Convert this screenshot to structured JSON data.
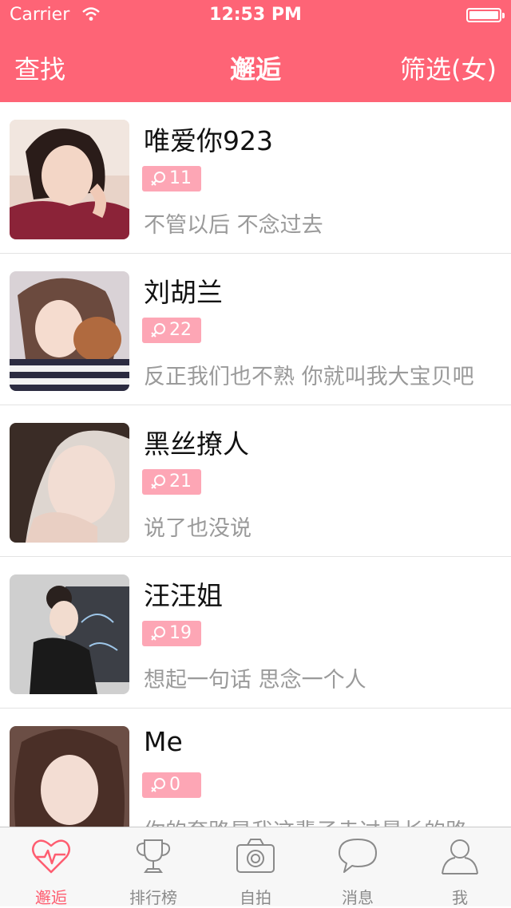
{
  "status_bar": {
    "carrier": "Carrier",
    "time": "12:53 PM"
  },
  "nav": {
    "left": "查找",
    "title": "邂逅",
    "right": "筛选(女)"
  },
  "users": [
    {
      "name": "唯爱你923",
      "age": "11",
      "motto": "不管以后 不念过去"
    },
    {
      "name": "刘胡兰",
      "age": "22",
      "motto": "反正我们也不熟 你就叫我大宝贝吧"
    },
    {
      "name": "黑丝撩人",
      "age": "21",
      "motto": "说了也没说"
    },
    {
      "name": "汪汪姐",
      "age": "19",
      "motto": "想起一句话 思念一个人"
    },
    {
      "name": "Me",
      "age": "0",
      "motto": "你的套路是我这辈子走过最长的路"
    }
  ],
  "tabs": [
    {
      "label": "邂逅",
      "icon": "heart-pulse-icon",
      "active": true
    },
    {
      "label": "排行榜",
      "icon": "trophy-icon"
    },
    {
      "label": "自拍",
      "icon": "camera-icon"
    },
    {
      "label": "消息",
      "icon": "chat-bubble-icon"
    },
    {
      "label": "我",
      "icon": "person-icon"
    }
  ],
  "colors": {
    "brand": "#fe6476",
    "badge": "#fda6b5",
    "tab_active": "#fe5d70"
  }
}
